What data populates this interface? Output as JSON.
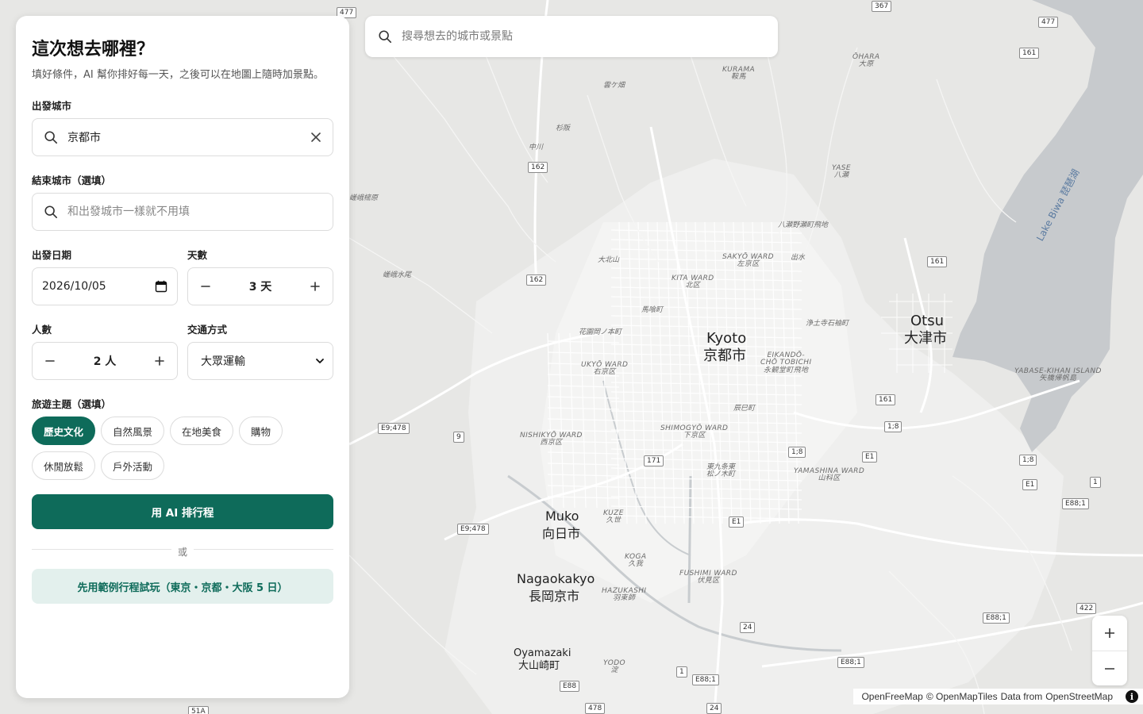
{
  "map": {
    "roads": [
      "477",
      "367",
      "477",
      "161",
      "162",
      "162",
      "161",
      "161",
      "171",
      "9",
      "E9;478",
      "E9;478",
      "1;8",
      "1;8",
      "E1",
      "1;8",
      "E1",
      "1",
      "E88;1",
      "E1",
      "24",
      "E88;1",
      "E88;1",
      "E88",
      "478",
      "24",
      "422",
      "E88;1",
      "51A"
    ],
    "labels": {
      "ohara": "ŌHARA\n大原",
      "kurama": "KURAMA\n鞍馬",
      "kumogahata": "雲ケ畑",
      "sugisaka": "杉阪",
      "nakagawa": "中川",
      "yase": "YASE\n八瀬",
      "sagashinmachi": "嵯峨樒原",
      "yaseairfield": "八瀬野瀬町飛地",
      "sakyo": "SAKYŌ WARD\n左京区",
      "demizu": "出水",
      "daimonjiyama": "大北山",
      "sagamizuo": "嵯峨水尾",
      "kita": "KITA WARD\n北区",
      "umakuicho": "馬喰町",
      "kyoto_en": "Kyoto",
      "kyoto_ja": "京都市",
      "otsu_en": "Otsu",
      "otsu_ja": "大津市",
      "jodoji": "浄土寺石袖町",
      "hanazono": "花園岡ノ本町",
      "ukyo": "UKYŌ WARD\n右京区",
      "eikando": "EIKANDŌ-\nCHŌ TOBICHI\n永観堂町飛地",
      "yabase": "YABASE-KIHAN ISLAND\n矢橋帰帆島",
      "tatsumicho": "辰巳町",
      "nishikyo": "NISHIKYŌ WARD\n西京区",
      "shimogyo": "SHIMOGYŌ WARD\n下京区",
      "higashikujo": "東九条東\n松ノ木町",
      "yamashina": "YAMASHINA WARD\n山科区",
      "muko_en": "Muko",
      "muko_ja": "向日市",
      "kuze": "KUZE\n久世",
      "koga": "KOGA\n久我",
      "fushimi": "FUSHIMI WARD\n伏見区",
      "nagaokakyo_en": "Nagaokakyo",
      "nagaokakyo_ja": "長岡京市",
      "hazukashi": "HAZUKASHI\n羽束師",
      "oyamazaki_en": "Oyamazaki",
      "oyamazaki_ja": "大山崎町",
      "yodo": "YODO\n淀",
      "lake": "Lake Biwa 琵琶湖"
    }
  },
  "top_search": {
    "placeholder": "搜尋想去的城市或景點",
    "icon": "search-icon"
  },
  "panel": {
    "title": "這次想去哪裡？",
    "subtitle": "填好條件，AI 幫你排好每一天，之後可以在地圖上隨時加景點。",
    "start_city": {
      "label": "出發城市",
      "value": "京都市"
    },
    "end_city": {
      "label": "結束城市（選填）",
      "placeholder": "和出發城市一樣就不用填"
    },
    "date": {
      "label": "出發日期",
      "value": "2026/10/05"
    },
    "days": {
      "label": "天數",
      "value": "3 天"
    },
    "people": {
      "label": "人數",
      "value": "2 人"
    },
    "transport": {
      "label": "交通方式",
      "value": "大眾運輸"
    },
    "themes": {
      "label": "旅遊主題（選填）",
      "items": [
        "歷史文化",
        "自然風景",
        "在地美食",
        "購物",
        "休閒放鬆",
        "戶外活動"
      ],
      "active": "歷史文化"
    },
    "primary_button": "用 AI 排行程",
    "divider": "或",
    "secondary_button": "先用範例行程試玩（東京・京都・大阪 5 日）"
  },
  "zoom": {
    "in": "+",
    "out": "−"
  },
  "attribution": {
    "a": "OpenFreeMap",
    "b": "© OpenMapTiles",
    "c": "Data from",
    "d": "OpenStreetMap",
    "info": "i"
  },
  "colors": {
    "accent": "#0e6b5a",
    "accent_soft": "#e3f0ed",
    "lake": "#c6c9cc",
    "land": "#e6e6e4"
  }
}
